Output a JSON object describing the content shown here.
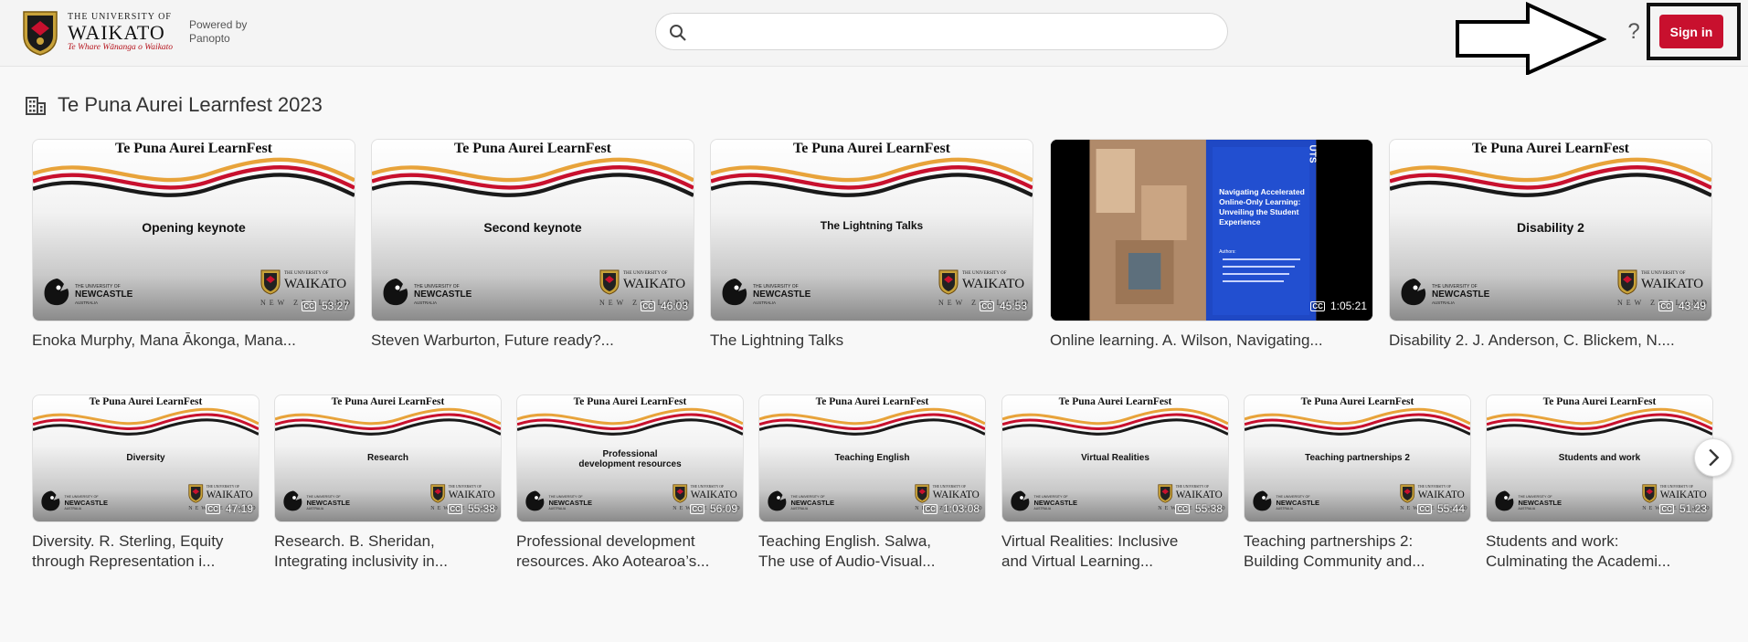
{
  "header": {
    "logo": {
      "small": "THE UNIVERSITY OF",
      "big": "WAIKATO",
      "maori": "Te Whare Wānanga o Waikato"
    },
    "powered_by": "Powered by Panopto",
    "search_placeholder": "",
    "help_label": "?",
    "sign_in_label": "Sign in"
  },
  "folder": {
    "title": "Te Puna Aurei Learnfest 2023"
  },
  "brand": {
    "learnfest_title": "Te Puna Aurei LearnFest",
    "accent": "#c8102e",
    "wave_colors": [
      "#e8a33a",
      "#c8102e",
      "#1a1a1a"
    ]
  },
  "row1": [
    {
      "label": "Opening keynote",
      "duration": "53:27",
      "caption": "Enoka Murphy, Mana Ākonga, Mana..."
    },
    {
      "label": "Second keynote",
      "duration": "46:03",
      "caption": "Steven Warburton, Future ready?..."
    },
    {
      "label": "The Lightning Talks",
      "duration": "45:53",
      "caption": "The Lightning Talks"
    },
    {
      "label": "Navigating Accelerated Online-Only Learning: Unveiling the Student Experience",
      "duration": "1:05:21",
      "caption": "Online learning. A. Wilson, Navigating...",
      "photo": true
    },
    {
      "label": "Disability 2",
      "duration": "43:49",
      "caption": "Disability 2. J. Anderson, C. Blickem, N...."
    }
  ],
  "row2": [
    {
      "label": "Diversity",
      "duration": "47:19",
      "caption": "Diversity. R. Sterling, Equity\nthrough Representation i..."
    },
    {
      "label": "Research",
      "duration": "55:38",
      "caption": "Research. B. Sheridan,\nIntegrating inclusivity in..."
    },
    {
      "label": "Professional\ndevelopment resources",
      "duration": "56:09",
      "caption": "Professional development\nresources. Ako Aotearoa’s..."
    },
    {
      "label": "Teaching English",
      "duration": "1:03:08",
      "caption": "Teaching English. Salwa,\nThe use of Audio-Visual..."
    },
    {
      "label": "Virtual Realities",
      "duration": "55:38",
      "caption": "Virtual Realities: Inclusive\nand Virtual Learning..."
    },
    {
      "label": "Teaching partnerships 2",
      "duration": "55:44",
      "caption": "Teaching partnerships 2:\nBuilding Community and..."
    },
    {
      "label": "Students and work",
      "duration": "51:23",
      "caption": "Students and work:\nCulminating the Academi..."
    }
  ],
  "photo_slide": {
    "uts": "UTS",
    "title": "Navigating Accelerated Online-Only Learning: Unveiling the Student Experience",
    "authors_head": "Authors:"
  },
  "logos": {
    "newcastle_small": "THE UNIVERSITY OF",
    "newcastle_big": "NEWCASTLE",
    "newcastle_country": "AUSTRALIA",
    "waikato_small": "THE UNIVERSITY OF",
    "waikato_big": "WAIKATO",
    "waikato_country": "NEW ZEALAND"
  },
  "icons": {
    "search": "search-icon",
    "folder": "building-icon",
    "next": "chevron-right-icon",
    "captions": "closed-captions-icon"
  }
}
